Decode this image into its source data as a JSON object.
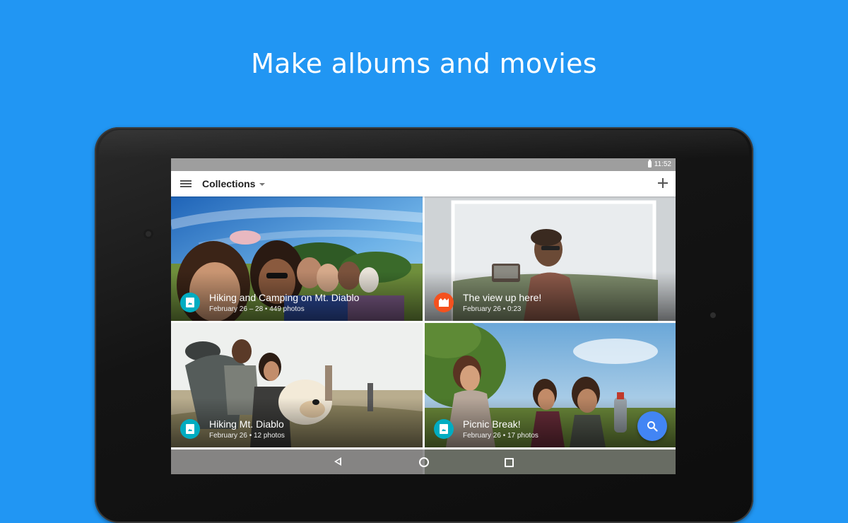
{
  "headline": "Make albums and movies",
  "status_bar": {
    "time": "11:52",
    "battery_icon": "battery-icon"
  },
  "app_bar": {
    "menu_icon": "menu-icon",
    "title": "Collections",
    "dropdown_icon": "dropdown-caret-icon",
    "add_icon": "add-icon"
  },
  "collections": [
    {
      "title": "Hiking and Camping on Mt. Diablo",
      "subtitle": "February 26 – 28 • 449 photos",
      "kind": "album",
      "icon": "album-icon",
      "badge_color": "#00ACC1"
    },
    {
      "title": "The view up here!",
      "subtitle": "February 26 • 0:23",
      "kind": "movie",
      "icon": "movie-icon",
      "badge_color": "#F4511E"
    },
    {
      "title": "Hiking Mt. Diablo",
      "subtitle": "February 26 • 12 photos",
      "kind": "album",
      "icon": "album-icon",
      "badge_color": "#00ACC1"
    },
    {
      "title": "Picnic Break!",
      "subtitle": "February 26 • 17 photos",
      "kind": "album",
      "icon": "album-icon",
      "badge_color": "#00ACC1"
    }
  ],
  "fab": {
    "icon": "search-icon",
    "color": "#4285F4"
  },
  "nav_bar": {
    "back_icon": "back-icon",
    "home_icon": "home-icon",
    "recents_icon": "recents-icon"
  },
  "colors": {
    "background": "#2196F3",
    "status_bar": "#9E9E9E",
    "app_bar": "#FFFFFF"
  }
}
